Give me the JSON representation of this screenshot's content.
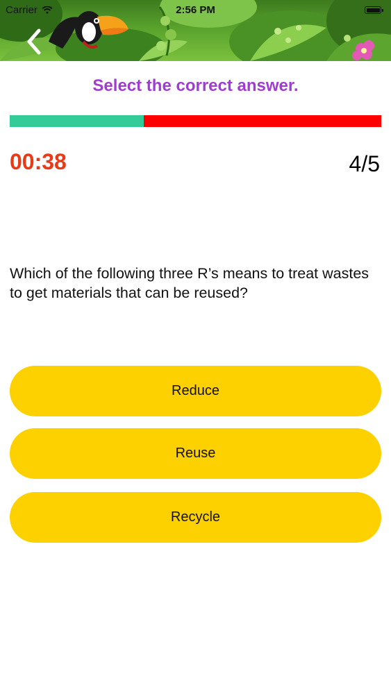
{
  "status_bar": {
    "carrier": "Carrier",
    "time": "2:56 PM",
    "icons": [
      "wifi-icon",
      "battery-icon"
    ]
  },
  "header": {
    "back_icon": "chevron-left-icon",
    "illustration": "toucan-in-jungle"
  },
  "quiz": {
    "instruction": "Select the correct answer.",
    "progress": {
      "elapsed_fraction": 0.36,
      "colors": {
        "elapsed": "#33cc99",
        "remaining": "#ff0000"
      }
    },
    "timer": "00:38",
    "counter": "4/5",
    "question": "Which of the following three R’s means to treat wastes to get materials that can be reused?",
    "options": [
      {
        "label": "Reduce"
      },
      {
        "label": "Reuse"
      },
      {
        "label": "Recycle"
      }
    ]
  },
  "colors": {
    "instruction": "#a13bd4",
    "timer": "#e83a17",
    "option_background": "#fdd000"
  }
}
